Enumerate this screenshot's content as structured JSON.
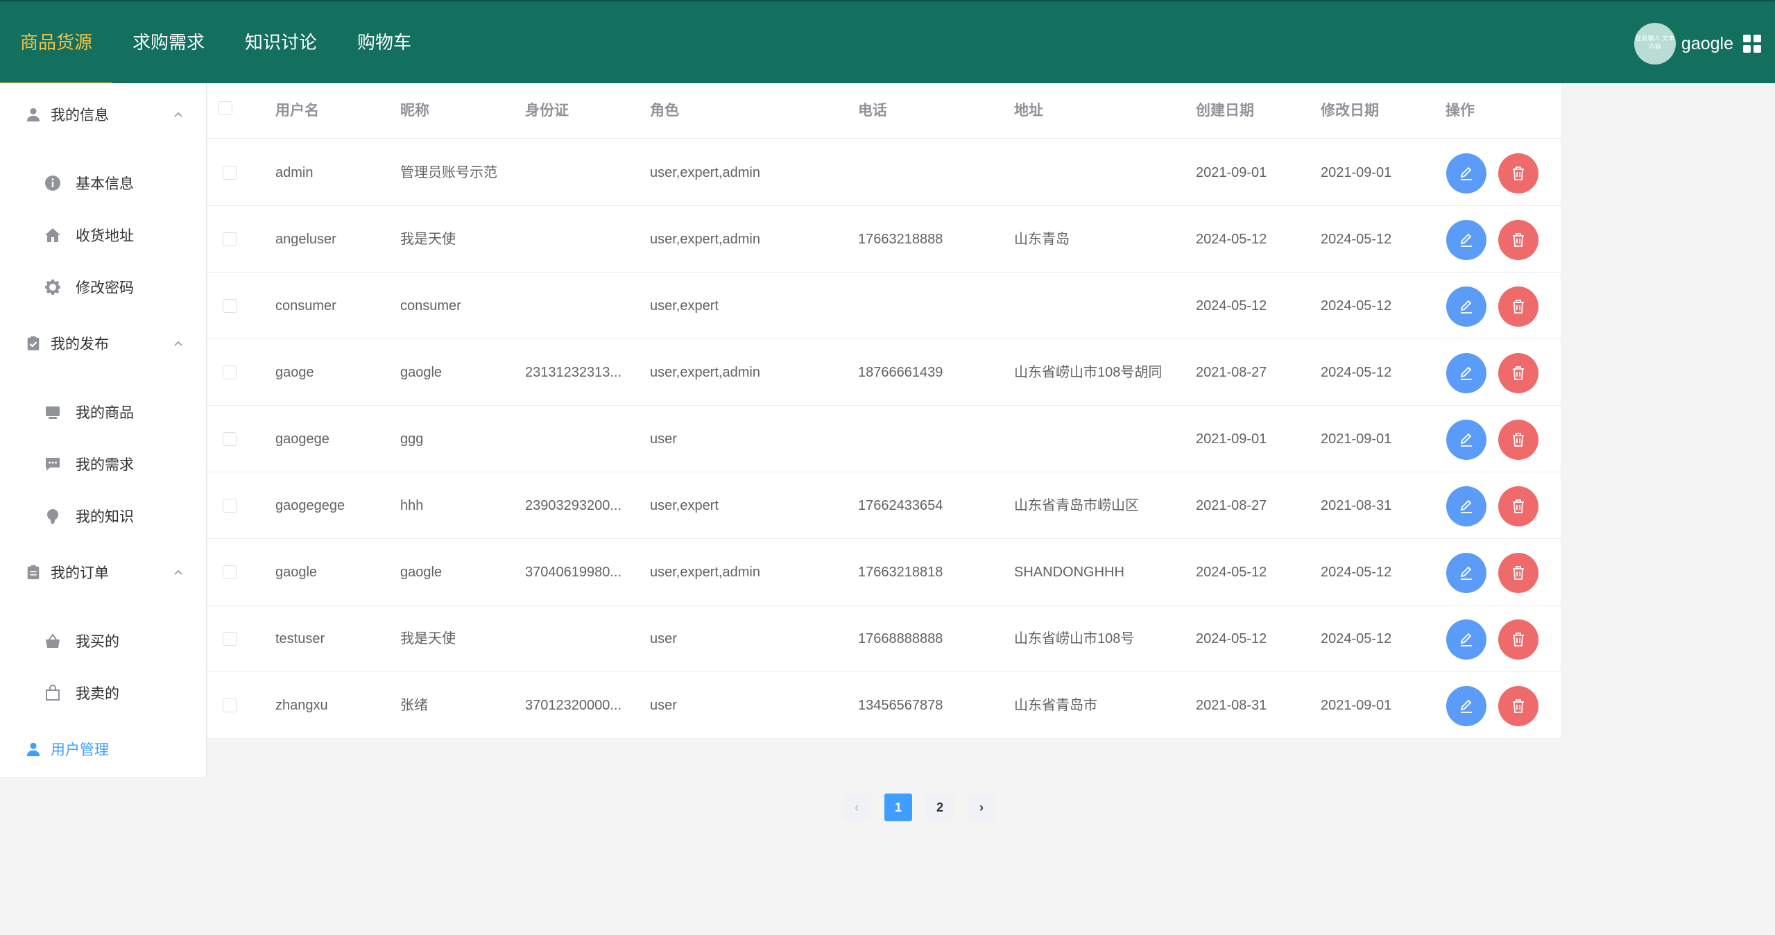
{
  "nav": {
    "items": [
      {
        "label": "商品货源"
      },
      {
        "label": "求购需求"
      },
      {
        "label": "知识讨论"
      },
      {
        "label": "购物车"
      }
    ],
    "active_index": 0,
    "user": {
      "name": "gaogle",
      "avatar_text": "在此输入 文本内容"
    }
  },
  "sidebar": {
    "groups": [
      {
        "label": "我的信息",
        "icon": "user-icon",
        "items": [
          {
            "label": "基本信息",
            "icon": "info-icon"
          },
          {
            "label": "收货地址",
            "icon": "home-icon"
          },
          {
            "label": "修改密码",
            "icon": "gear-icon"
          }
        ]
      },
      {
        "label": "我的发布",
        "icon": "clipboard-check-icon",
        "items": [
          {
            "label": "我的商品",
            "icon": "monitor-icon"
          },
          {
            "label": "我的需求",
            "icon": "chat-icon"
          },
          {
            "label": "我的知识",
            "icon": "bulb-icon"
          }
        ]
      },
      {
        "label": "我的订单",
        "icon": "order-icon",
        "items": [
          {
            "label": "我买的",
            "icon": "basket-icon"
          },
          {
            "label": "我卖的",
            "icon": "bag-icon"
          }
        ]
      }
    ],
    "user_management": {
      "label": "用户管理",
      "icon": "user-admin-icon"
    }
  },
  "table": {
    "headers": [
      "用户名",
      "昵称",
      "身份证",
      "角色",
      "电话",
      "地址",
      "创建日期",
      "修改日期",
      "操作"
    ],
    "rows": [
      {
        "username": "admin",
        "nickname": "管理员账号示范",
        "id_card": "",
        "roles": "user,expert,admin",
        "phone": "",
        "address": "",
        "created": "2021-09-01",
        "modified": "2021-09-01"
      },
      {
        "username": "angeluser",
        "nickname": "我是天使",
        "id_card": "",
        "roles": "user,expert,admin",
        "phone": "17663218888",
        "address": "山东青岛",
        "created": "2024-05-12",
        "modified": "2024-05-12"
      },
      {
        "username": "consumer",
        "nickname": "consumer",
        "id_card": "",
        "roles": "user,expert",
        "phone": "",
        "address": "",
        "created": "2024-05-12",
        "modified": "2024-05-12"
      },
      {
        "username": "gaoge",
        "nickname": "gaogle",
        "id_card": "23131232313...",
        "roles": "user,expert,admin",
        "phone": "18766661439",
        "address": "山东省崂山市108号胡同",
        "created": "2021-08-27",
        "modified": "2024-05-12"
      },
      {
        "username": "gaogege",
        "nickname": "ggg",
        "id_card": "",
        "roles": "user",
        "phone": "",
        "address": "",
        "created": "2021-09-01",
        "modified": "2021-09-01"
      },
      {
        "username": "gaogegege",
        "nickname": "hhh",
        "id_card": "23903293200...",
        "roles": "user,expert",
        "phone": "17662433654",
        "address": "山东省青岛市崂山区",
        "created": "2021-08-27",
        "modified": "2021-08-31"
      },
      {
        "username": "gaogle",
        "nickname": "gaogle",
        "id_card": "37040619980...",
        "roles": "user,expert,admin",
        "phone": "17663218818",
        "address": "SHANDONGHHH",
        "created": "2024-05-12",
        "modified": "2024-05-12"
      },
      {
        "username": "testuser",
        "nickname": "我是天使",
        "id_card": "",
        "roles": "user",
        "phone": "17668888888",
        "address": "山东省崂山市108号",
        "created": "2024-05-12",
        "modified": "2024-05-12"
      },
      {
        "username": "zhangxu",
        "nickname": "张绪",
        "id_card": "37012320000...",
        "roles": "user",
        "phone": "13456567878",
        "address": "山东省青岛市",
        "created": "2021-08-31",
        "modified": "2021-09-01"
      }
    ]
  },
  "pagination": {
    "prev": "‹",
    "next": "›",
    "pages": [
      "1",
      "2"
    ],
    "current": "1"
  },
  "colors": {
    "header_bg": "#136f5e",
    "nav_active": "#f5c242",
    "primary": "#409eff",
    "edit_button": "#5a9cf8",
    "delete_button": "#ef6b6b"
  }
}
